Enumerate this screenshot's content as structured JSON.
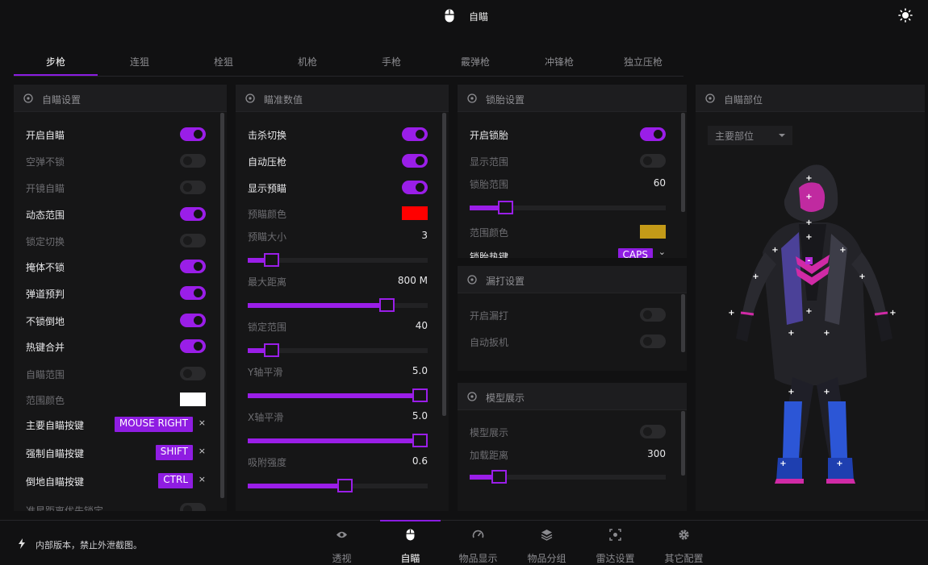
{
  "header": {
    "title": "自瞄",
    "mouse_icon": "mouse-icon",
    "theme_icon": "sun-icon"
  },
  "tabs": [
    "步枪",
    "连狙",
    "栓狙",
    "机枪",
    "手枪",
    "霰弹枪",
    "冲锋枪",
    "独立压枪"
  ],
  "active_tab": "步枪",
  "aim_settings": {
    "title": "自瞄设置",
    "items": [
      {
        "label": "开启自瞄",
        "on": true
      },
      {
        "label": "空弹不锁",
        "on": false
      },
      {
        "label": "开镜自瞄",
        "on": false
      },
      {
        "label": "动态范围",
        "on": true
      },
      {
        "label": "锁定切换",
        "on": false
      },
      {
        "label": "掩体不锁",
        "on": true
      },
      {
        "label": "弹道预判",
        "on": true
      },
      {
        "label": "不锁倒地",
        "on": true
      },
      {
        "label": "热键合并",
        "on": true
      },
      {
        "label": "自瞄范围",
        "on": false
      }
    ],
    "range_color_label": "范围颜色",
    "range_color": "#ffffff",
    "keys": [
      {
        "label": "主要自瞄按键",
        "key": "MOUSE RIGHT",
        "x": "×"
      },
      {
        "label": "强制自瞄按键",
        "key": "SHIFT",
        "x": "×"
      },
      {
        "label": "倒地自瞄按键",
        "key": "CTRL",
        "x": "×"
      }
    ],
    "cut_label": "准星距离优先锁定"
  },
  "aim_values": {
    "title": "瞄准数值",
    "toggles": [
      {
        "label": "击杀切换",
        "on": true
      },
      {
        "label": "自动压枪",
        "on": true
      },
      {
        "label": "显示预瞄",
        "on": true
      }
    ],
    "pre_color_label": "预瞄颜色",
    "pre_color": "#ff0000",
    "sliders": [
      {
        "label": "预瞄大小",
        "value": "3",
        "fraction": 0.13
      },
      {
        "label": "最大距离",
        "value": "800 M",
        "fraction": 0.77
      },
      {
        "label": "锁定范围",
        "value": "40",
        "fraction": 0.13
      },
      {
        "label": "Y轴平滑",
        "value": "5.0",
        "fraction": 1.0
      },
      {
        "label": "X轴平滑",
        "value": "5.0",
        "fraction": 1.0
      },
      {
        "label": "吸附强度",
        "value": "0.6",
        "fraction": 0.54
      }
    ]
  },
  "lock_settings": {
    "title": "锁胎设置",
    "items": [
      {
        "label": "开启锁胎",
        "on": true
      },
      {
        "label": "显示范围",
        "on": false
      }
    ],
    "range_label": "锁胎范围",
    "range_value": "60",
    "range_fraction": 0.18,
    "color_label": "范围颜色",
    "color": "#c39a18",
    "hotkey_label": "锁胎热键",
    "hotkey": "CAPS"
  },
  "miss_settings": {
    "title": "漏打设置",
    "items": [
      {
        "label": "开启漏打",
        "on": false
      },
      {
        "label": "自动扳机",
        "on": false
      }
    ]
  },
  "model_settings": {
    "title": "模型展示",
    "toggle": {
      "label": "模型展示",
      "on": false
    },
    "dist_label": "加载距离",
    "dist_value": "300",
    "dist_fraction": 0.15
  },
  "aim_parts": {
    "title": "自瞄部位",
    "dropdown": "主要部位"
  },
  "footer": {
    "notice": "内部版本，禁止外泄截图。",
    "nav": [
      {
        "label": "透视",
        "icon": "eye-icon"
      },
      {
        "label": "自瞄",
        "icon": "mouse-icon"
      },
      {
        "label": "物品显示",
        "icon": "gauge-icon"
      },
      {
        "label": "物品分组",
        "icon": "layers-icon"
      },
      {
        "label": "雷达设置",
        "icon": "radar-icon"
      },
      {
        "label": "其它配置",
        "icon": "gear-icon"
      }
    ],
    "active": "自瞄"
  }
}
